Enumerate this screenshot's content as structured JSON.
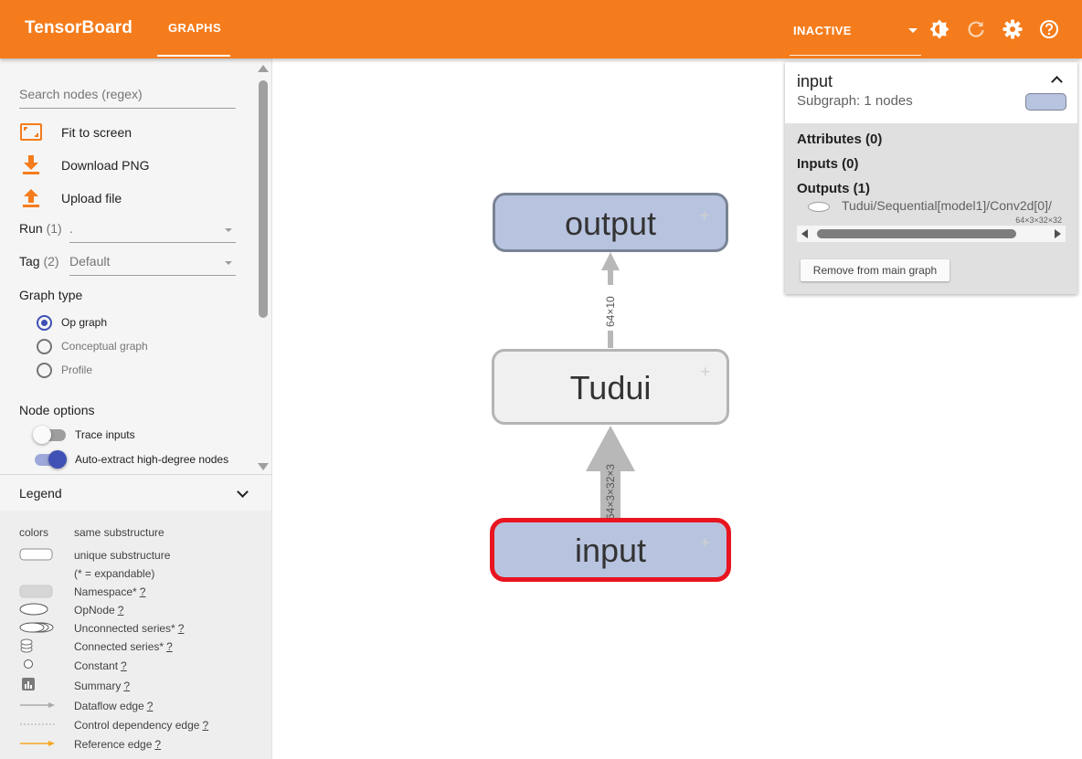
{
  "header": {
    "brand": "TensorBoard",
    "tab": "GRAPHS",
    "plugin_select": "INACTIVE",
    "icons": [
      "brightness-icon",
      "refresh-icon",
      "settings-icon",
      "help-icon"
    ],
    "background_color": "#f57c1c"
  },
  "sidebar": {
    "search_placeholder": "Search nodes (regex)",
    "actions": {
      "fit": "Fit to screen",
      "download": "Download PNG",
      "upload": "Upload file"
    },
    "run": {
      "label": "Run",
      "count": "(1)",
      "value": "."
    },
    "tag": {
      "label": "Tag",
      "count": "(2)",
      "value": "Default"
    },
    "graph_type": {
      "title": "Graph type",
      "options": [
        "Op graph",
        "Conceptual graph",
        "Profile"
      ],
      "selected": "Op graph"
    },
    "node_options": {
      "title": "Node options",
      "trace_inputs": {
        "label": "Trace inputs",
        "on": false
      },
      "auto_extract": {
        "label": "Auto-extract high-degree nodes",
        "on": true
      }
    }
  },
  "legend": {
    "title": "Legend",
    "colors": "colors",
    "same_substructure": "same substructure",
    "unique_substructure": "unique substructure",
    "expandable_note": "(* = expandable)",
    "items": {
      "namespace": "Namespace*",
      "opnode": "OpNode",
      "unconnected": "Unconnected series*",
      "connected": "Connected series*",
      "constant": "Constant",
      "summary": "Summary",
      "dataflow": "Dataflow edge",
      "control": "Control dependency edge",
      "reference": "Reference edge"
    },
    "help_mark": "?"
  },
  "graph": {
    "nodes": {
      "output": "output",
      "tudui": "Tudui",
      "input": "input"
    },
    "edges": {
      "tudui_to_output": "64×10",
      "input_to_tudui": "64×3×32×3"
    },
    "colors": {
      "namespace_fill": "#b8c4df",
      "opnode_fill": "#f0f0f0",
      "selected_border": "#e8141f",
      "edge": "#b8b8b8"
    }
  },
  "info_panel": {
    "name": "input",
    "subtitle": "Subgraph: 1 nodes",
    "attributes": "Attributes (0)",
    "inputs": "Inputs (0)",
    "outputs": "Outputs (1)",
    "output_item": "Tudui/Sequential[model1]/Conv2d[0]/",
    "output_shape": "64×3×32×32",
    "remove_button": "Remove from main graph"
  }
}
